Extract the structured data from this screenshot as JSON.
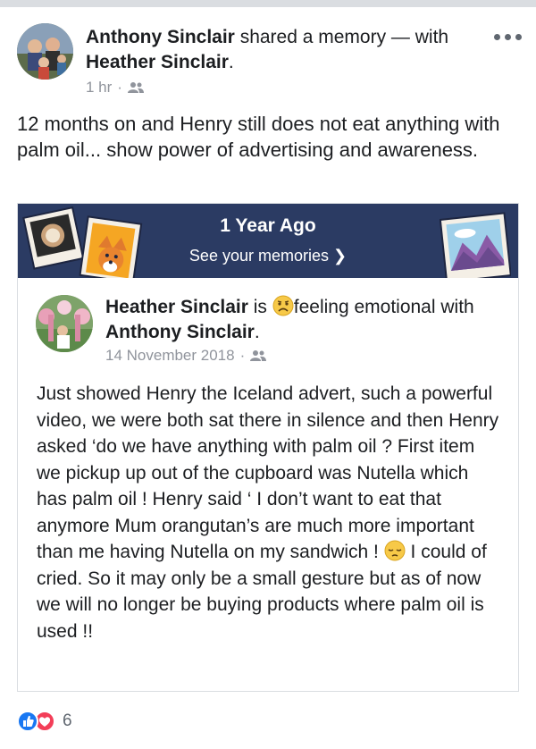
{
  "post": {
    "author": "Anthony Sinclair",
    "action": " shared a memory — with ",
    "tagged": "Heather Sinclair",
    "tagged_suffix": ".",
    "time": "1 hr",
    "dot": "·",
    "privacy_icon": "friends-icon",
    "more_icon": "more-options-icon",
    "text": "12 months on and Henry still does not eat anything with palm oil... show power of advertising and awareness."
  },
  "memory": {
    "banner_title": "1 Year Ago",
    "banner_link": "See your memories ❯",
    "banner_color": "#2b3b63",
    "shared": {
      "author": "Heather Sinclair",
      "is_text": " is ",
      "feeling_icon": "sad-face-icon",
      "feeling": "feeling emotional",
      "with_text": " with ",
      "with_name": "Anthony Sinclair",
      "with_suffix": ".",
      "date": "14 November 2018",
      "dot": "·",
      "privacy_icon": "friends-icon",
      "text_part1": "Just showed Henry the Iceland advert, such a powerful video, we were both sat there in silence and then Henry asked ‘do we have anything with palm oil ? First item we pickup up out of the cupboard was Nutella which has palm oil ! Henry said ‘ I don’t want to eat that anymore Mum orangutan’s are much more important than me having Nutella on my sandwich ! ",
      "emoji": "pensive-face-icon",
      "text_part2": " I could of cried. So it may only be a small gesture but as of now we will no longer be buying products where palm oil is used !!"
    }
  },
  "reactions": {
    "icons": [
      "like-icon",
      "love-icon"
    ],
    "count": "6",
    "like_color": "#1877f2",
    "love_color": "#f33e58"
  }
}
